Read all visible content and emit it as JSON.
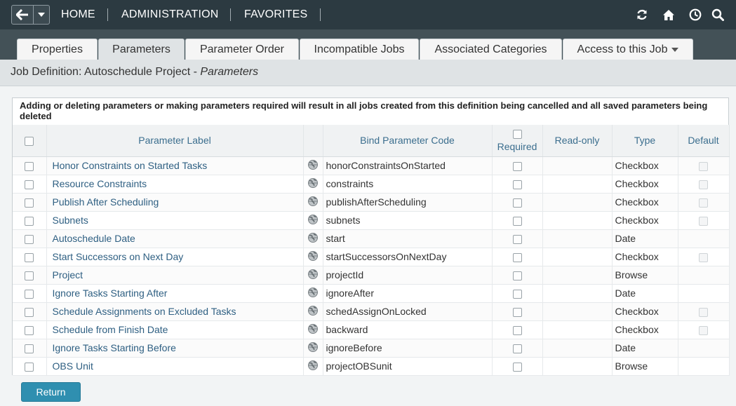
{
  "nav": {
    "links": [
      "HOME",
      "ADMINISTRATION",
      "FAVORITES"
    ],
    "icons": [
      "refresh-icon",
      "home-icon",
      "clock-icon",
      "search-icon"
    ]
  },
  "tabs": [
    {
      "label": "Properties",
      "active": false
    },
    {
      "label": "Parameters",
      "active": true
    },
    {
      "label": "Parameter Order",
      "active": false
    },
    {
      "label": "Incompatible Jobs",
      "active": false
    },
    {
      "label": "Associated Categories",
      "active": false
    },
    {
      "label": "Access to this Job",
      "active": false,
      "dropdown": true
    }
  ],
  "title": {
    "prefix": "Job Definition: Autoschedule Project - ",
    "section": "Parameters"
  },
  "warning": "Adding or deleting parameters or making parameters required will result in all jobs created from this definition being cancelled and all saved parameters being deleted",
  "columns": {
    "label": "Parameter Label",
    "code": "Bind Parameter Code",
    "required": "Required",
    "readonly": "Read-only",
    "type": "Type",
    "default": "Default"
  },
  "rows": [
    {
      "label": "Honor Constraints on Started Tasks",
      "code": "honorConstraintsOnStarted",
      "type": "Checkbox",
      "has_default": true
    },
    {
      "label": "Resource Constraints",
      "code": "constraints",
      "type": "Checkbox",
      "has_default": true
    },
    {
      "label": "Publish After Scheduling",
      "code": "publishAfterScheduling",
      "type": "Checkbox",
      "has_default": true
    },
    {
      "label": "Subnets",
      "code": "subnets",
      "type": "Checkbox",
      "has_default": true
    },
    {
      "label": "Autoschedule Date",
      "code": "start",
      "type": "Date",
      "has_default": false
    },
    {
      "label": "Start Successors on Next Day",
      "code": "startSuccessorsOnNextDay",
      "type": "Checkbox",
      "has_default": true
    },
    {
      "label": "Project",
      "code": "projectId",
      "type": "Browse",
      "has_default": false
    },
    {
      "label": "Ignore Tasks Starting After",
      "code": "ignoreAfter",
      "type": "Date",
      "has_default": false
    },
    {
      "label": "Schedule Assignments on Excluded Tasks",
      "code": "schedAssignOnLocked",
      "type": "Checkbox",
      "has_default": true
    },
    {
      "label": "Schedule from Finish Date",
      "code": "backward",
      "type": "Checkbox",
      "has_default": true
    },
    {
      "label": "Ignore Tasks Starting Before",
      "code": "ignoreBefore",
      "type": "Date",
      "has_default": false
    },
    {
      "label": "OBS Unit",
      "code": "projectOBSunit",
      "type": "Browse",
      "has_default": false
    }
  ],
  "buttons": {
    "return": "Return"
  },
  "colors": {
    "nav_bg": "#2c3a41",
    "tab_band": "#435157",
    "link": "#2e5f82",
    "button": "#2f8fb0"
  }
}
